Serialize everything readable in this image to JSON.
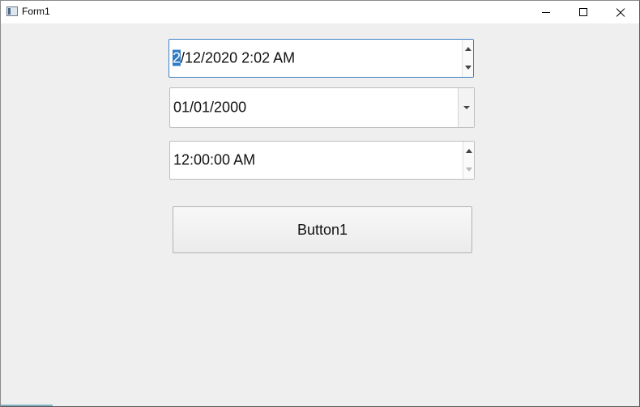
{
  "window": {
    "title": "Form1",
    "icons": {
      "app": "form-app-icon",
      "minimize": "minimize-icon",
      "maximize": "maximize-icon",
      "close": "close-icon"
    }
  },
  "datetime_spinner": {
    "value_selected": "2",
    "value_rest": "/12/2020 2:02 AM"
  },
  "date_dropdown": {
    "value": "01/01/2000"
  },
  "time_spinner": {
    "value": "12:00:00 AM"
  },
  "button1": {
    "label": "Button1"
  },
  "colors": {
    "focus_border": "#3f7fc4",
    "selection": "#2f7cc5",
    "form_background": "#efefef"
  }
}
